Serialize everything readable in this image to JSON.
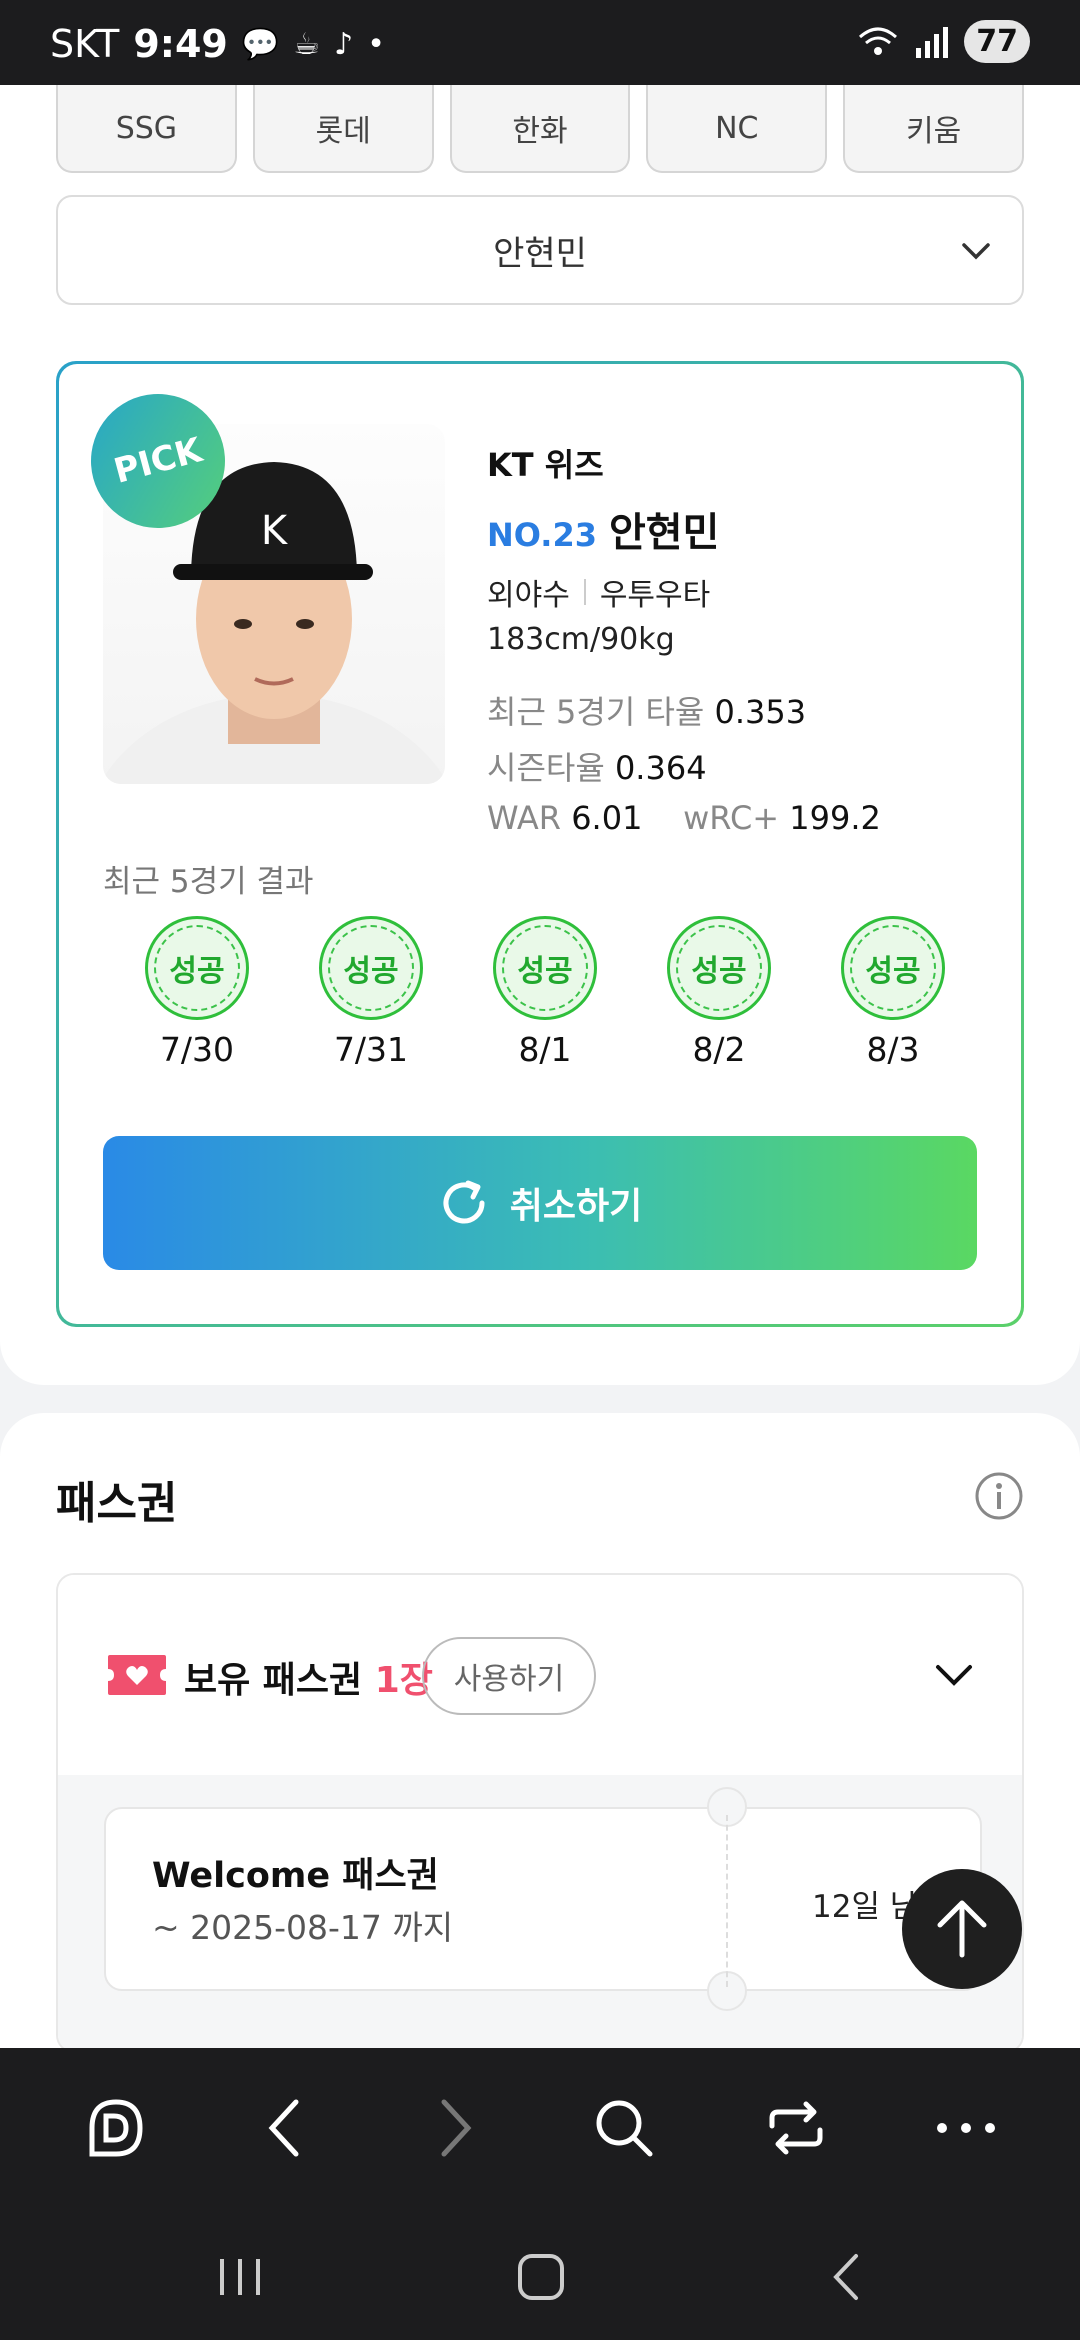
{
  "status_bar": {
    "carrier": "SKT",
    "time": "9:49",
    "battery": "77"
  },
  "team_tabs": [
    "SSG",
    "롯데",
    "한화",
    "NC",
    "키움"
  ],
  "player_select": {
    "value": "안현민"
  },
  "player_card": {
    "pick_badge": "PICK",
    "team": "KT 위즈",
    "number": "NO.23",
    "name": "안현민",
    "position": "외야수",
    "bats_throws": "우투우타",
    "body": "183cm/90kg",
    "stats": {
      "recent5_label": "최근 5경기 타율",
      "recent5_value": "0.353",
      "season_label": "시즌타율",
      "season_value": "0.364",
      "war_label": "WAR",
      "war_value": "6.01",
      "wrc_label": "wRC+",
      "wrc_value": "199.2"
    },
    "recent_results_label": "최근 5경기 결과",
    "results": [
      {
        "status": "성공",
        "date": "7/30"
      },
      {
        "status": "성공",
        "date": "7/31"
      },
      {
        "status": "성공",
        "date": "8/1"
      },
      {
        "status": "성공",
        "date": "8/2"
      },
      {
        "status": "성공",
        "date": "8/3"
      }
    ],
    "cancel_label": "취소하기"
  },
  "pass_section": {
    "title": "패스권",
    "owned_label": "보유 패스권",
    "owned_count": "1장",
    "use_label": "사용하기",
    "ticket": {
      "title": "Welcome 패스권",
      "expiry": "~ 2025-08-17 까지",
      "remaining": "12일 남음"
    }
  },
  "colors": {
    "accent_blue": "#2a7de1",
    "accent_green": "#5ad862",
    "pass_pink": "#f0506e",
    "success_green": "#21a82e"
  }
}
